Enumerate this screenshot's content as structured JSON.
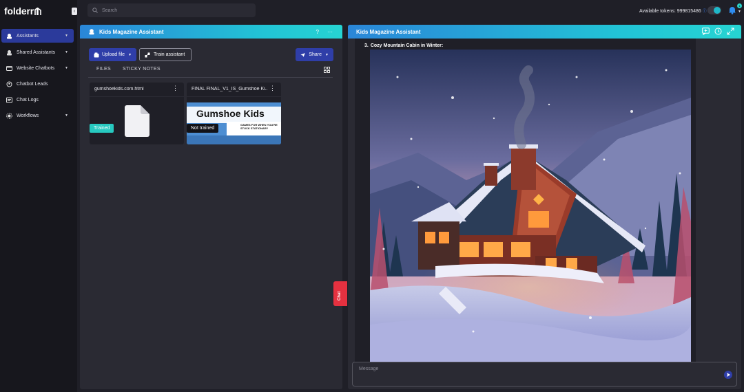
{
  "app": {
    "logo": "folderr"
  },
  "sidebar": {
    "items": [
      {
        "label": "Assistants",
        "icon": "bot-icon",
        "has_chevron": true,
        "active": true
      },
      {
        "label": "Shared Assistants",
        "icon": "shared-bot-icon",
        "has_chevron": true,
        "active": false
      },
      {
        "label": "Website Chatbots",
        "icon": "browser-icon",
        "has_chevron": true,
        "active": false
      },
      {
        "label": "Chatbot Leads",
        "icon": "leads-icon",
        "has_chevron": false,
        "active": false
      },
      {
        "label": "Chat Logs",
        "icon": "chat-log-icon",
        "has_chevron": false,
        "active": false
      },
      {
        "label": "Workflows",
        "icon": "workflow-icon",
        "has_chevron": true,
        "active": false
      }
    ]
  },
  "topbar": {
    "search_placeholder": "Search",
    "tokens_label": "Available tokens: 999815486",
    "bell_badge": "1"
  },
  "left_panel": {
    "title": "Kids Magazine Assistant",
    "help": "?",
    "more": "···",
    "upload_label": "Upload file",
    "train_label": "Train assistant",
    "share_label": "Share",
    "tabs": [
      "FILES",
      "STICKY NOTES"
    ],
    "files": [
      {
        "name": "gumshoekids.com.html",
        "status": "Trained"
      },
      {
        "name": "FINAL FINAL_V1_IS_Gumshoe Ki...",
        "status": "Not trained",
        "thumb_title": "Gumshoe Kids",
        "thumb_subtitle": "GAMES FOR WHEN YOU'RE STUCK STATIONARY"
      }
    ]
  },
  "chat_tab": {
    "label": "Chat"
  },
  "right_panel": {
    "title": "Kids Magazine Assistant",
    "message": {
      "number": "3.",
      "heading": "Cozy Mountain Cabin in Winter:"
    },
    "composer_placeholder": "Message"
  },
  "colors": {
    "accent": "#2f3ea8",
    "header_gradient_start": "#2a86d8",
    "header_gradient_end": "#26d4d2",
    "trained": "#27c9c0",
    "chat_tab": "#e53140"
  }
}
